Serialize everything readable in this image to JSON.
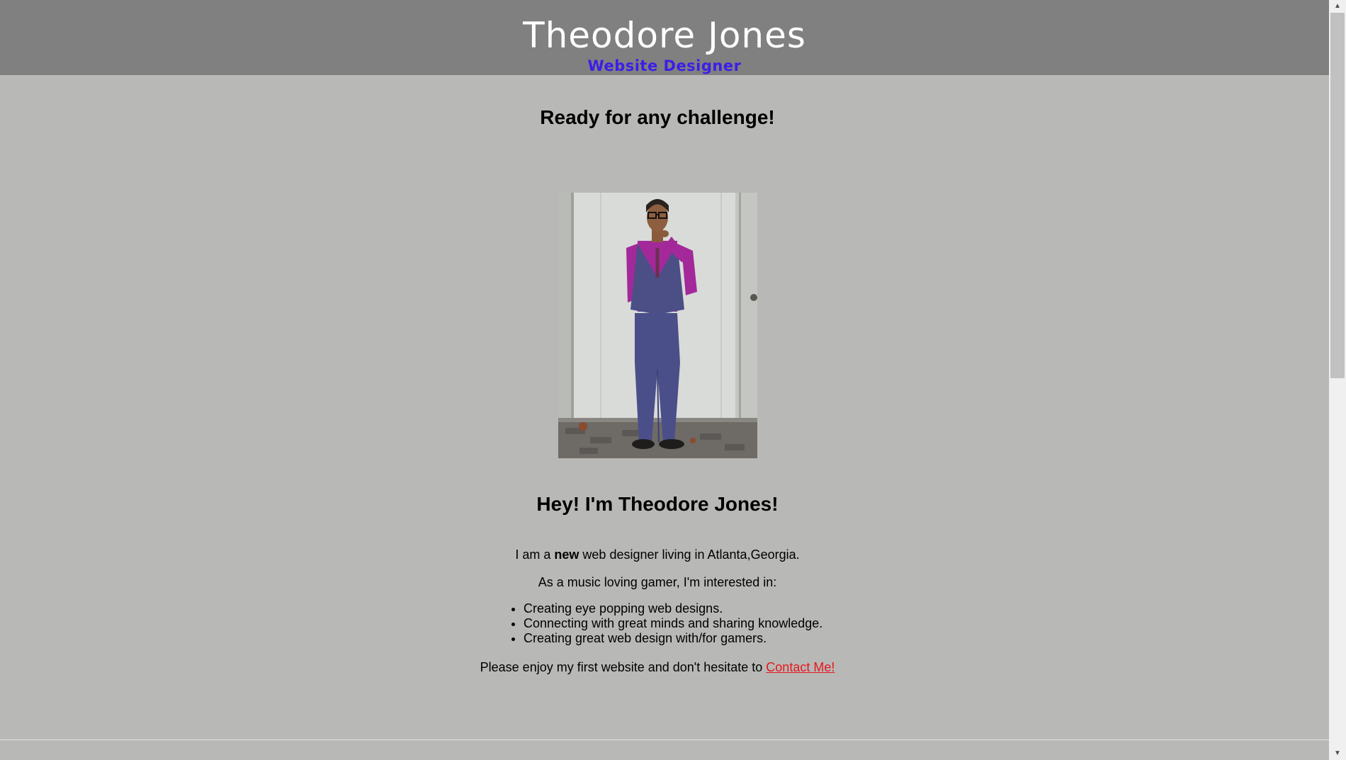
{
  "header": {
    "title": "Theodore Jones",
    "subtitle": "Website Designer"
  },
  "main": {
    "tagline": "Ready for any challenge!",
    "portrait_alt": "Photo of Theodore Jones",
    "intro_heading": "Hey! I'm Theodore Jones!",
    "bio": {
      "before": "I am a ",
      "emphasis": "new",
      "after": " web designer living in Atlanta,Georgia."
    },
    "interests_intro": "As a music loving gamer, I'm interested in:",
    "interests": [
      "Creating eye popping web designs.",
      "Connecting with great minds and sharing knowledge.",
      "Creating great web design with/for gamers."
    ],
    "closing": "Please enjoy my first website and don't hesitate to ",
    "contact_link": "Contact Me!"
  },
  "scrollbar": {
    "up_icon": "scroll-up-arrow-icon",
    "down_icon": "scroll-down-arrow-icon"
  },
  "colors": {
    "header_bg": "#808080",
    "page_bg": "#b8b8b6",
    "subtitle": "#3b1ee8",
    "link": "#e8161c"
  }
}
